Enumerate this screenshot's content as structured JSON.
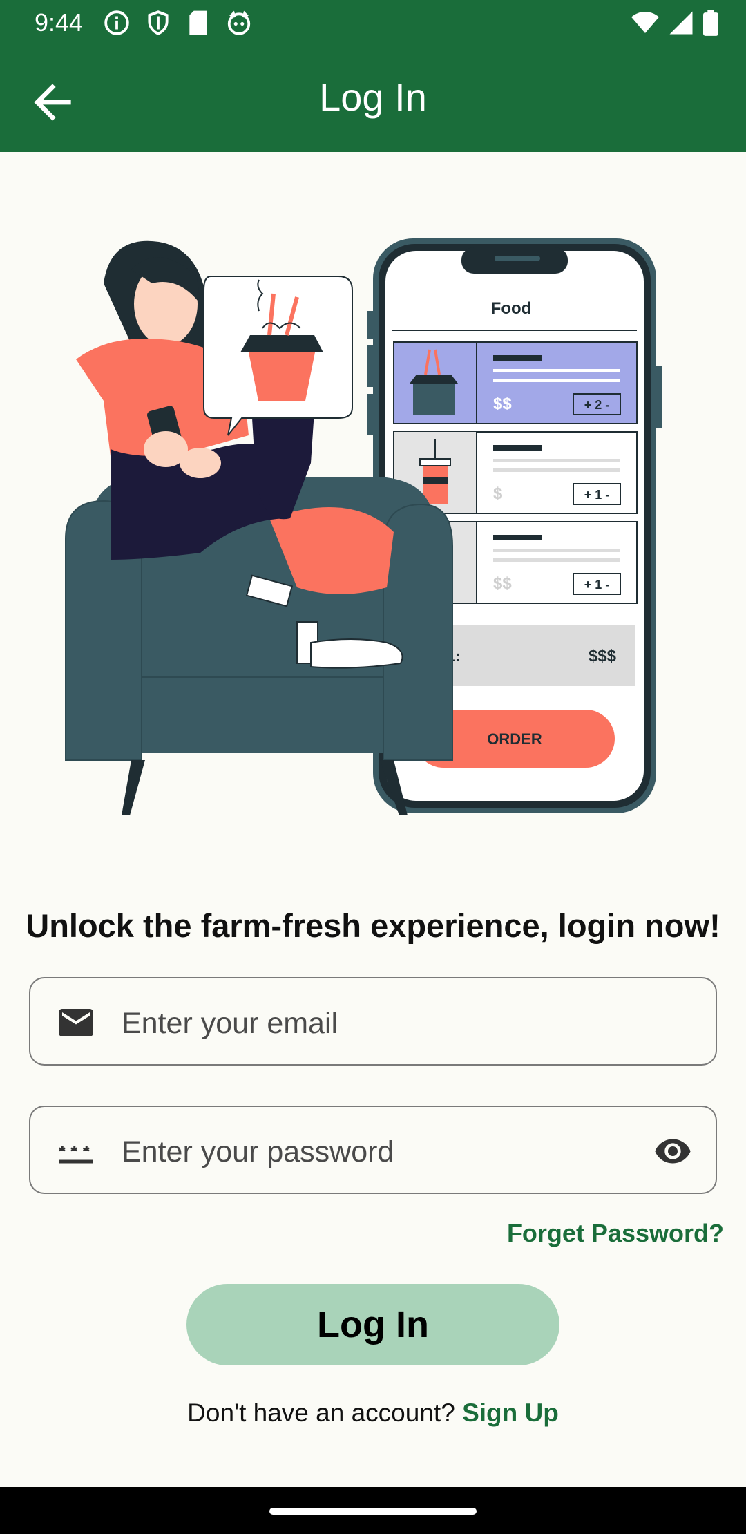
{
  "status_bar": {
    "time": "9:44",
    "left_icons": [
      "info-icon",
      "shield-icon",
      "sd-card-icon",
      "cat-icon"
    ],
    "right_icons": [
      "wifi-icon",
      "signal-icon",
      "battery-icon"
    ]
  },
  "app_bar": {
    "title": "Log In",
    "back_icon": "arrow-back-icon",
    "color": "#1a6d3a"
  },
  "illustration": {
    "phone_header": "Food",
    "items": [
      {
        "price": "$$",
        "qty": "+ 2 -"
      },
      {
        "price": "$",
        "qty": "+ 1 -"
      },
      {
        "price": "$$",
        "qty": "+ 1 -"
      }
    ],
    "total_label": "AL:",
    "total_value": "$$$",
    "order_button": "ORDER"
  },
  "headline": "Unlock the farm-fresh experience, login now!",
  "form": {
    "email_placeholder": "Enter your email",
    "password_placeholder": "Enter your password",
    "email_icon": "mail-icon",
    "password_icon": "password-icon",
    "visibility_icon": "eye-icon"
  },
  "forgot_password": "Forget Password?",
  "login_button": "Log In",
  "signup": {
    "prompt": "Don't have an account?",
    "link": "Sign Up"
  },
  "colors": {
    "primary": "#1a6d3a",
    "button_bg": "#a9d3b9",
    "accent_coral": "#fb735f",
    "chair": "#3a5a63"
  }
}
